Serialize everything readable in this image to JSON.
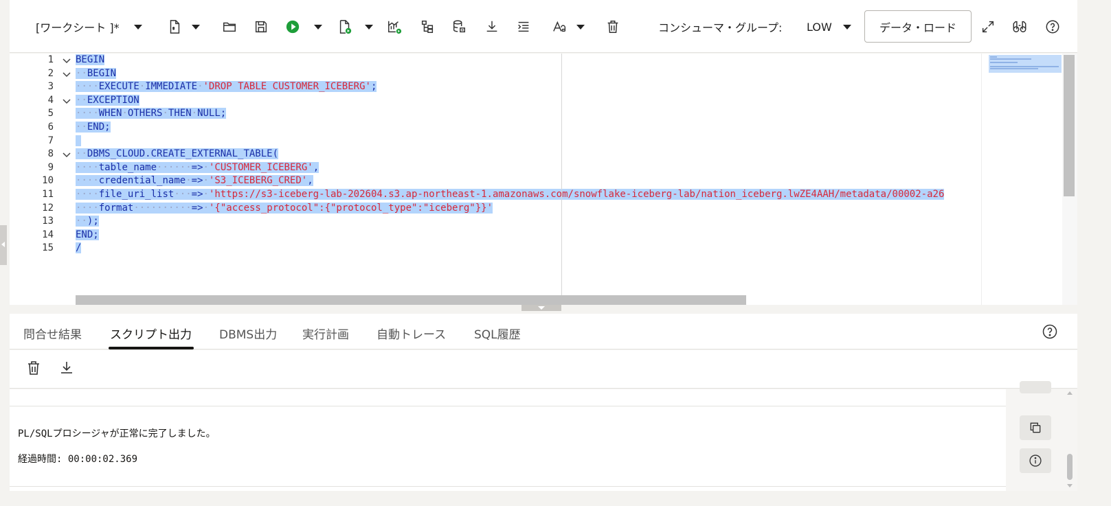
{
  "toolbar": {
    "worksheet_title": "[ワークシート ]*",
    "consumer_group_label": "コンシューマ・グループ:",
    "consumer_group_value": "LOW",
    "data_load_label": "データ・ロード"
  },
  "editor": {
    "line_numbers": [
      "1",
      "2",
      "3",
      "4",
      "5",
      "6",
      "7",
      "8",
      "9",
      "10",
      "11",
      "12",
      "13",
      "14",
      "15"
    ],
    "lines": [
      "BEGIN",
      "  BEGIN",
      "    EXECUTE IMMEDIATE 'DROP TABLE CUSTOMER_ICEBERG';",
      "  EXCEPTION",
      "    WHEN OTHERS THEN NULL;",
      "  END;",
      "",
      "  DBMS_CLOUD.CREATE_EXTERNAL_TABLE(",
      "    table_name      => 'CUSTOMER_ICEBERG',",
      "    credential_name => 'S3_ICEBERG_CRED',",
      "    file_uri_list   => 'https://s3-iceberg-lab-202604.s3.ap-northeast-1.amazonaws.com/snowflake-iceberg-lab/nation_iceberg.lwZE4AAH/metadata/00002-a26",
      "    format          => '{\"access_protocol\":{\"protocol_type\":\"iceberg\"}}'",
      "  );",
      "END;",
      "/"
    ]
  },
  "tabs": [
    {
      "label": "問合せ結果"
    },
    {
      "label": "スクリプト出力"
    },
    {
      "label": "DBMS出力"
    },
    {
      "label": "実行計画"
    },
    {
      "label": "自動トレース"
    },
    {
      "label": "SQL履歴"
    }
  ],
  "output": {
    "message": "PL/SQLプロシージャが正常に完了しました。",
    "elapsed": "経過時間: 00:00:02.369"
  },
  "colors": {
    "keyword": "#1a2fa8",
    "string": "#d6293a",
    "selection": "#b3d4fc",
    "run_green": "#1e9e3a"
  },
  "icons": [
    "dropdown-caret-icon",
    "new-file-icon",
    "open-folder-icon",
    "save-icon",
    "run-statement-icon",
    "run-script-icon",
    "autotrace-icon",
    "explain-plan-icon",
    "database-icon",
    "download-icon",
    "format-icon",
    "font-size-icon",
    "trash-icon",
    "expand-icon",
    "binoculars-icon",
    "help-icon",
    "copy-icon",
    "info-icon"
  ]
}
